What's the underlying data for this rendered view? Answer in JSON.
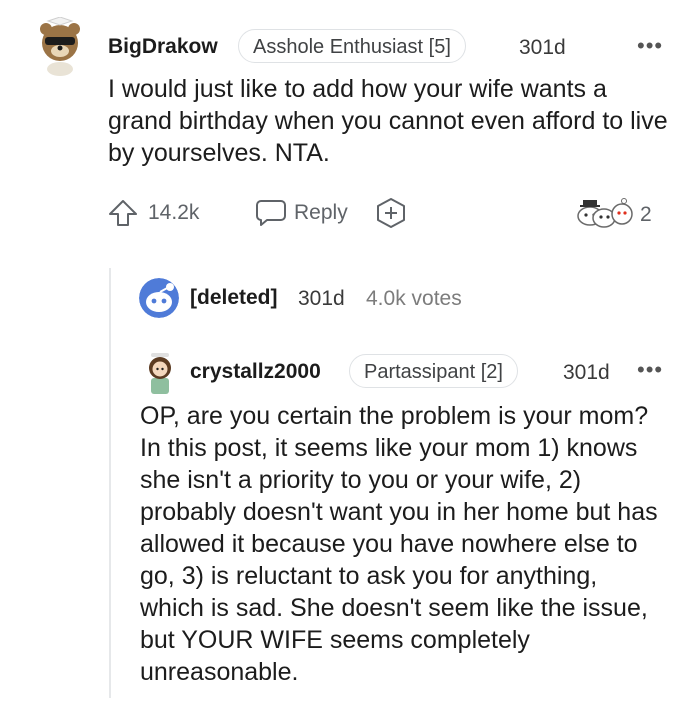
{
  "comments": [
    {
      "username": "BigDrakow",
      "flair": "Asshole Enthusiast [5]",
      "age": "301d",
      "more": "•••",
      "body": "I would just like to add how your wife wants a grand birthday when you cannot even afford to live by yourselves. NTA.",
      "votes": "14.2k",
      "reply_label": "Reply",
      "awards_count": "2"
    },
    {
      "username": "[deleted]",
      "age": "301d",
      "votes": "4.0k votes"
    },
    {
      "username": "crystallz2000",
      "flair": "Partassipant [2]",
      "age": "301d",
      "more": "•••",
      "body": "OP, are you certain the problem is your mom? In this post, it seems like your mom 1) knows she isn't a priority to you or your wife, 2) probably doesn't want you in her home but has allowed it because you have nowhere else to go, 3) is reluctant to ask you for anything, which is sad. She doesn't seem like the issue, but YOUR WIFE seems completely unreasonable."
    }
  ],
  "icons": {
    "upvote": "upvote-arrow-icon",
    "reply": "speech-bubble-icon",
    "award": "award-plus-icon",
    "awards": "snoo-awards-icon"
  },
  "colors": {
    "text": "#1c1c1c",
    "muted": "#5f6368",
    "flair_border": "#dfe2e5",
    "thread_line": "#e6e8ea"
  }
}
